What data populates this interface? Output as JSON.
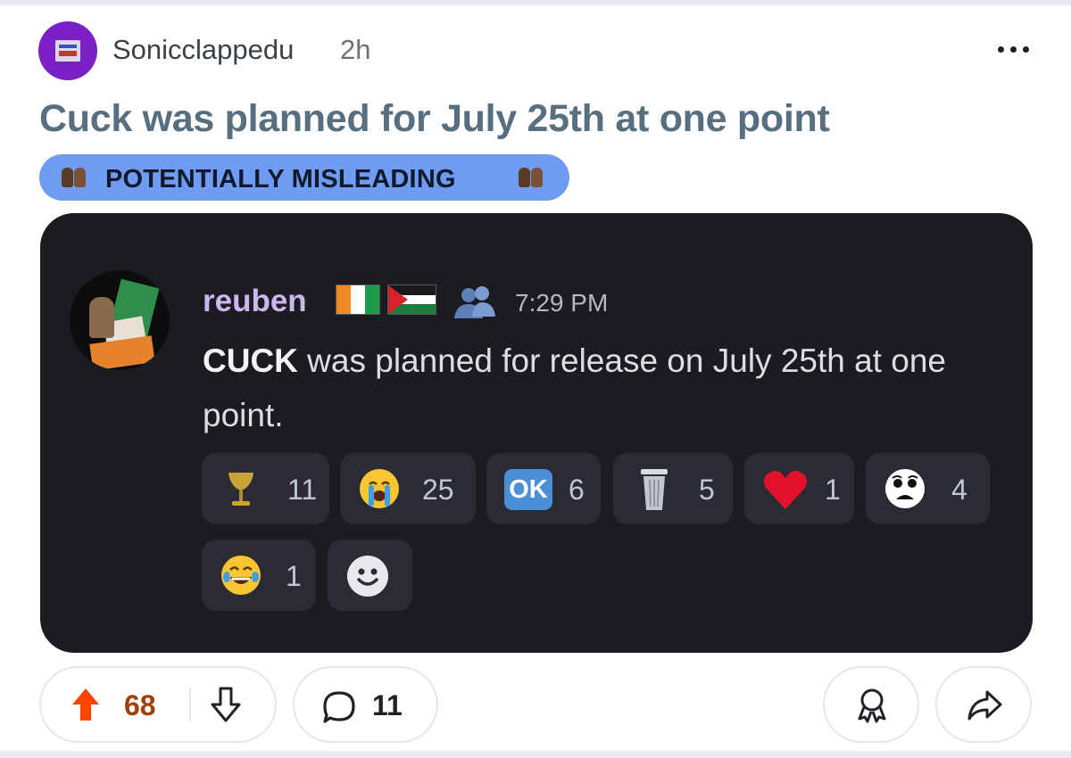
{
  "post": {
    "author": "Sonicclappedu",
    "age": "2h",
    "title": "Cuck was planned for July 25th at one point",
    "flair": "POTENTIALLY MISLEADING",
    "more_icon": "more-horizontal-icon"
  },
  "message": {
    "author": "reuben",
    "time": "7:29 PM",
    "body_bold": "CUCK",
    "body_rest": " was planned for release on July 25th at one point.",
    "author_color": "#cab7ee",
    "badges": [
      "cote-divoire-flag",
      "palestine-flag",
      "people-icon"
    ]
  },
  "reactions": [
    {
      "icon": "goblet-icon",
      "count": "11"
    },
    {
      "icon": "loudly-crying-face-icon",
      "count": "25"
    },
    {
      "icon": "ok-button-icon",
      "label": "OK",
      "count": "6"
    },
    {
      "icon": "wastebasket-icon",
      "count": "5"
    },
    {
      "icon": "red-heart-icon",
      "count": "1"
    },
    {
      "icon": "sad-face-icon",
      "count": "4"
    },
    {
      "icon": "tears-of-joy-icon",
      "count": "1"
    },
    {
      "icon": "add-reaction-icon"
    }
  ],
  "footer": {
    "upvotes": "68",
    "comments": "11",
    "upvote_color": "#ff4500",
    "vote_count_color": "#a03f0a"
  },
  "colors": {
    "card_bg": "#1b1b21",
    "flair_bg": "#6f9cf2",
    "title": "#576f7f"
  }
}
